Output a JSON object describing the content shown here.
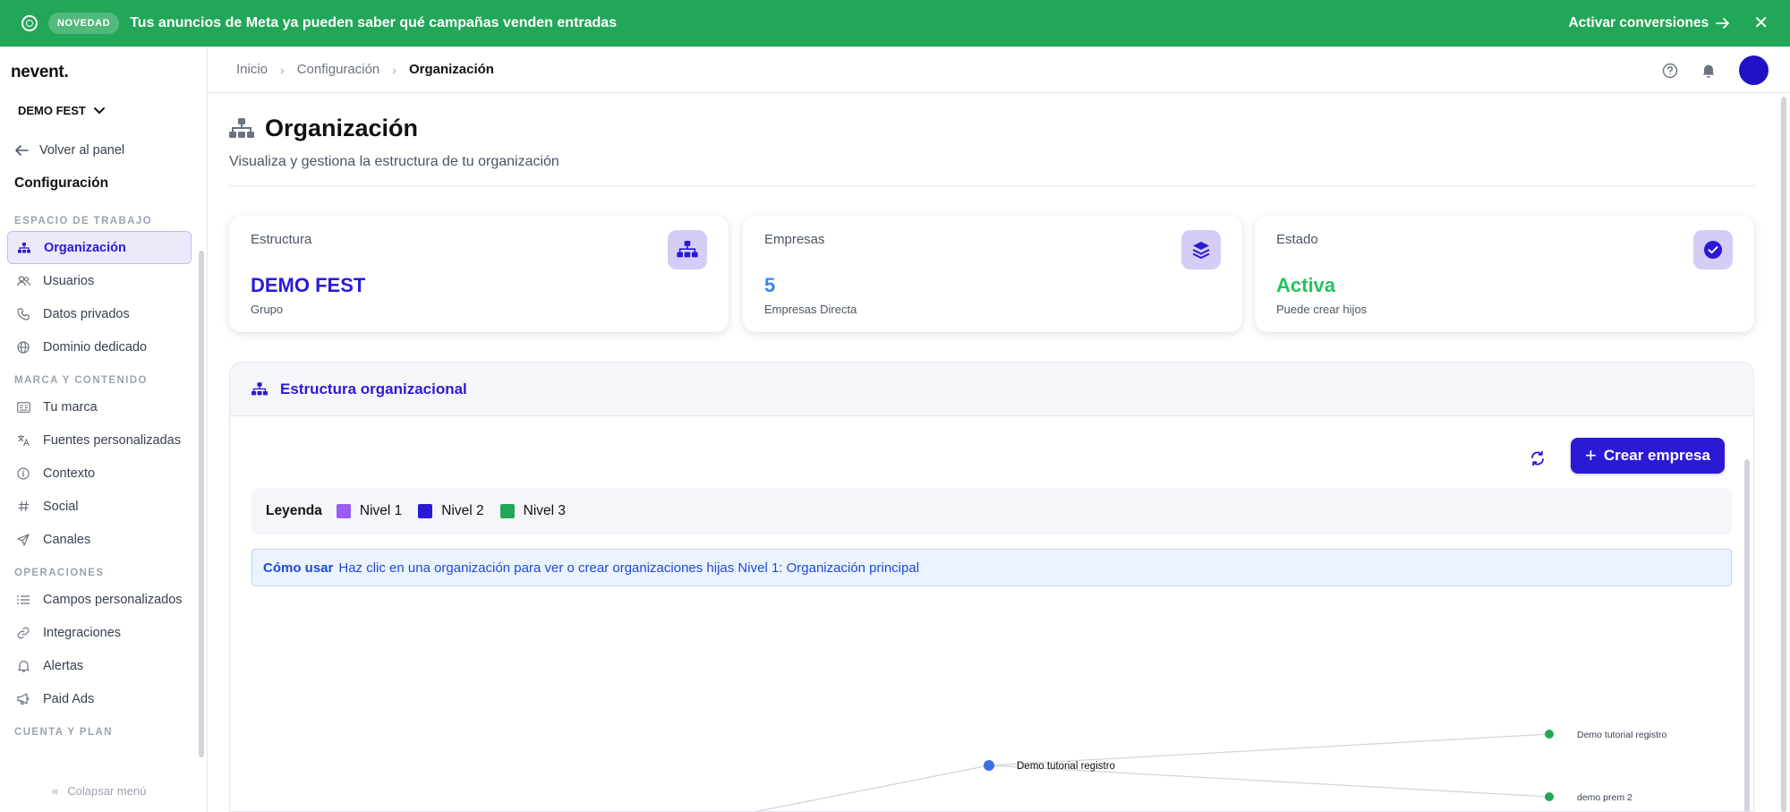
{
  "banner": {
    "badge": "NOVEDAD",
    "message": "Tus anuncios de Meta ya pueden saber qué campañas venden entradas",
    "cta": "Activar conversiones",
    "bg_color": "#22a658"
  },
  "sidebar": {
    "logo": "nevent.",
    "org_selector": "DEMO FEST",
    "back_label": "Volver al panel",
    "title": "Configuración",
    "sections": [
      {
        "label": "ESPACIO DE TRABAJO",
        "items": [
          {
            "label": "Organización",
            "icon": "org-tree-icon",
            "active": true
          },
          {
            "label": "Usuarios",
            "icon": "users-icon",
            "active": false
          },
          {
            "label": "Datos privados",
            "icon": "phone-icon",
            "active": false
          },
          {
            "label": "Dominio dedicado",
            "icon": "globe-icon",
            "active": false
          }
        ]
      },
      {
        "label": "MARCA Y CONTENIDO",
        "items": [
          {
            "label": "Tu marca",
            "icon": "id-card-icon",
            "active": false
          },
          {
            "label": "Fuentes personalizadas",
            "icon": "translate-icon",
            "active": false
          },
          {
            "label": "Contexto",
            "icon": "info-icon",
            "active": false
          },
          {
            "label": "Social",
            "icon": "hashtag-icon",
            "active": false
          },
          {
            "label": "Canales",
            "icon": "send-icon",
            "active": false
          }
        ]
      },
      {
        "label": "OPERACIONES",
        "items": [
          {
            "label": "Campos personalizados",
            "icon": "list-icon",
            "active": false
          },
          {
            "label": "Integraciones",
            "icon": "link-icon",
            "active": false
          },
          {
            "label": "Alertas",
            "icon": "bell-icon",
            "active": false
          },
          {
            "label": "Paid Ads",
            "icon": "megaphone-icon",
            "active": false
          }
        ]
      },
      {
        "label": "CUENTA Y PLAN",
        "items": []
      }
    ],
    "collapse_label": "Colapsar menú"
  },
  "header": {
    "breadcrumbs": [
      "Inicio",
      "Configuración",
      "Organización"
    ]
  },
  "page": {
    "title": "Organización",
    "subtitle": "Visualiza y gestiona la estructura de tu organización"
  },
  "cards": [
    {
      "label": "Estructura",
      "value": "DEMO FEST",
      "sub": "Grupo",
      "value_color": "#2a1ad6",
      "icon": "org-tree-icon"
    },
    {
      "label": "Empresas",
      "value": "5",
      "sub": "Empresas Directa",
      "value_color": "#3b82f6",
      "icon": "layers-icon"
    },
    {
      "label": "Estado",
      "value": "Activa",
      "sub": "Puede crear hijos",
      "value_color": "#22c55e",
      "icon": "check-circle-icon"
    }
  ],
  "structure": {
    "title": "Estructura organizacional",
    "create_button": "Crear empresa",
    "legend_title": "Leyenda",
    "legend": [
      {
        "label": "Nivel 1",
        "color": "#9b5cf6"
      },
      {
        "label": "Nivel 2",
        "color": "#2a1ad6"
      },
      {
        "label": "Nivel 3",
        "color": "#22a658"
      }
    ],
    "howto_title": "Cómo usar",
    "howto_text": "Haz clic en una organización para ver o crear organizaciones hijas Nivel 1: Organización principal",
    "nodes": [
      {
        "label": "Demo tutorial registro",
        "level": 2
      },
      {
        "label": "Demo tutorial registro",
        "level": 3
      },
      {
        "label": "demo prem 2",
        "level": 3
      }
    ]
  },
  "colors": {
    "accent": "#2a1ad6",
    "banner": "#22a658"
  }
}
